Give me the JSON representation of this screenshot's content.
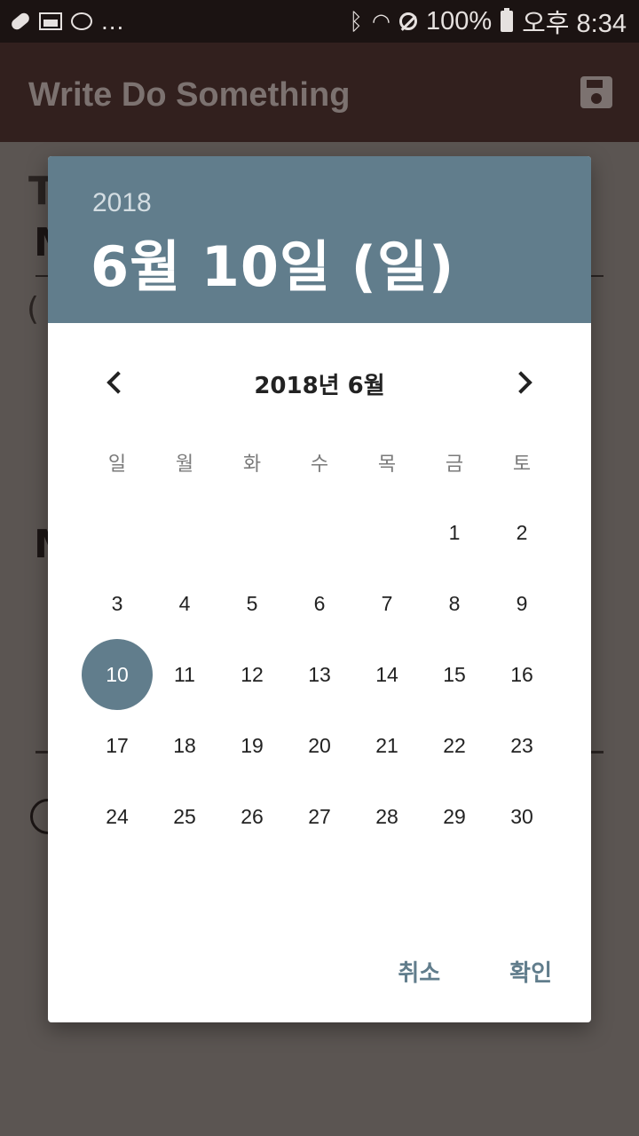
{
  "status_bar": {
    "left_icons": [
      "pill-icon",
      "gallery-icon",
      "loop-icon"
    ],
    "more": "...",
    "battery_percent": "100%",
    "time": "오후 8:34"
  },
  "app_bar": {
    "title": "Write Do Something",
    "save_icon": "save-icon"
  },
  "background": {
    "heading_fragment": "T",
    "label_fragment_1": "M",
    "paren_fragment": "(",
    "label_fragment_2": "M"
  },
  "date_picker": {
    "header": {
      "year": "2018",
      "selected_date": "6월 10일 (일)"
    },
    "month_label": "2018년 6월",
    "weekdays": [
      "일",
      "월",
      "화",
      "수",
      "목",
      "금",
      "토"
    ],
    "leading_blanks": 5,
    "days": [
      "1",
      "2",
      "3",
      "4",
      "5",
      "6",
      "7",
      "8",
      "9",
      "10",
      "11",
      "12",
      "13",
      "14",
      "15",
      "16",
      "17",
      "18",
      "19",
      "20",
      "21",
      "22",
      "23",
      "24",
      "25",
      "26",
      "27",
      "28",
      "29",
      "30"
    ],
    "selected_day": "10",
    "cancel_label": "취소",
    "confirm_label": "확인"
  },
  "colors": {
    "accent": "#617d8c",
    "app_bar": "#32201e",
    "scrim": "#5b5552"
  }
}
